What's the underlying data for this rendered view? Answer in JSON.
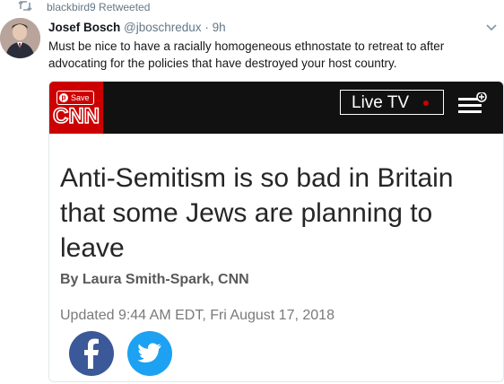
{
  "retweet": {
    "icon": "retweet-icon",
    "text": "blackbird9 Retweeted"
  },
  "tweet": {
    "author_name": "Josef Bosch",
    "handle": "@jboschredux",
    "separator": "·",
    "time": "9h",
    "text": "Must be nice to have a racially homogeneous ethnostate to retreat to after advocating for the policies that have destroyed your host country."
  },
  "card": {
    "save_label": "Save",
    "brand": "CNN",
    "live_tv_label": "Live TV",
    "headline": "Anti-Semitism is so bad in Britain that some Jews are planning to leave",
    "byline": "By Laura Smith-Spark, CNN",
    "updated": "Updated 9:44 AM EDT, Fri August 17, 2018"
  },
  "colors": {
    "cnn_red": "#cc0000",
    "facebook_blue": "#3b5998",
    "twitter_blue": "#1da1f2",
    "muted": "#657786"
  }
}
